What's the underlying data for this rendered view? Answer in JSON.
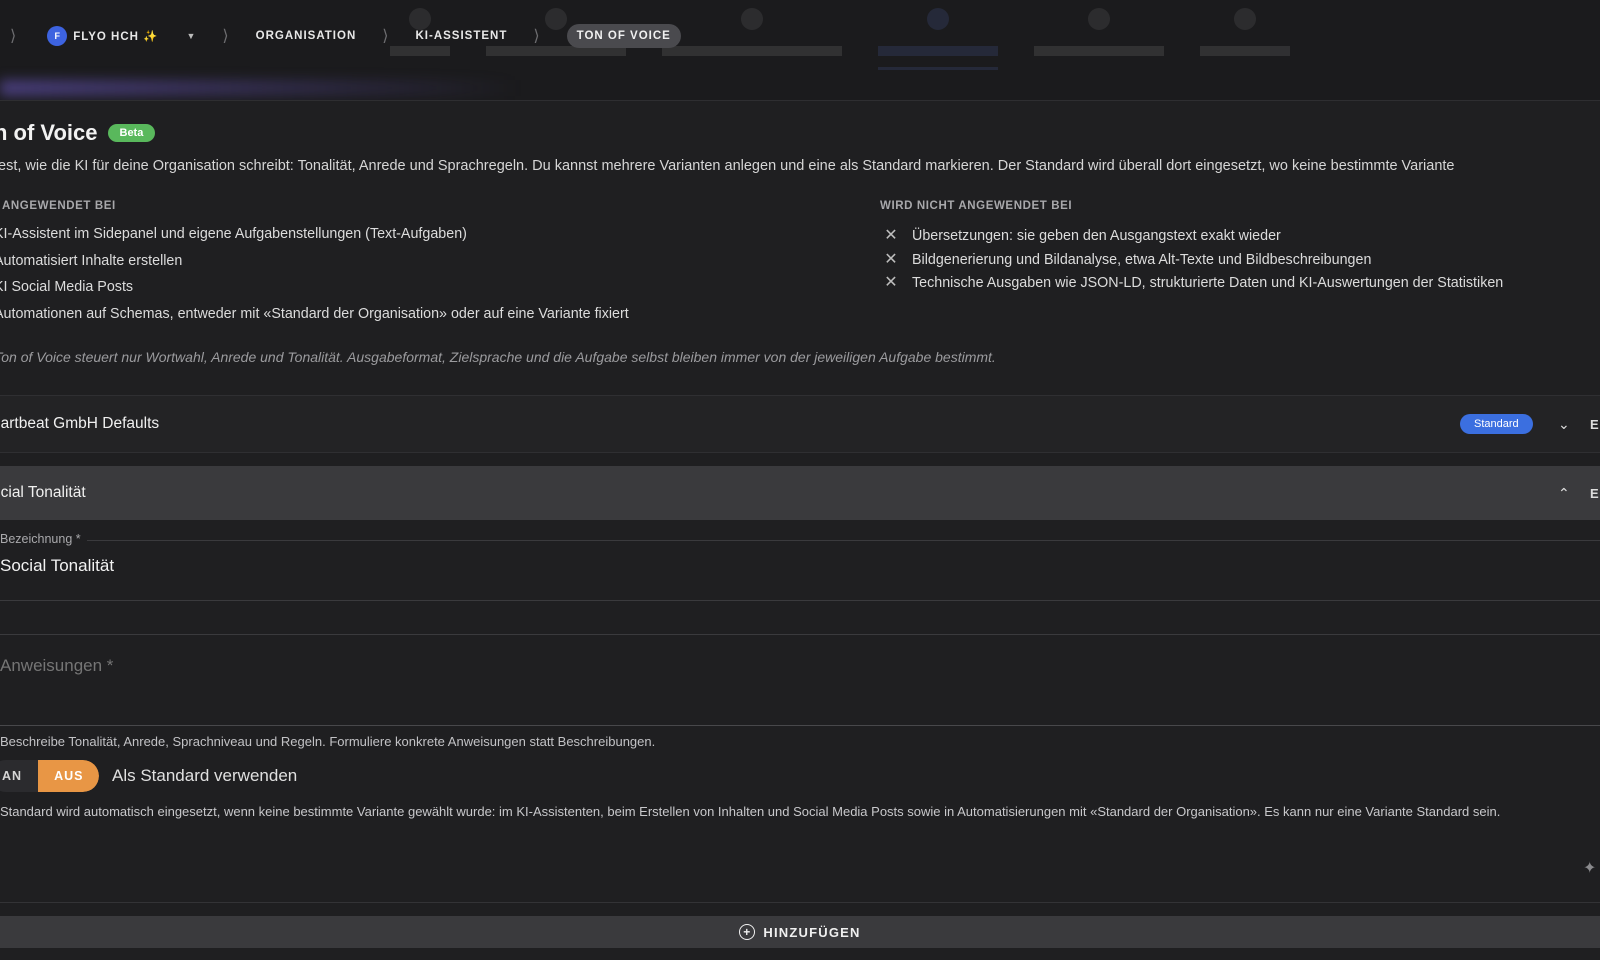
{
  "breadcrumb": {
    "org_avatar": "F",
    "org_name": "FLYO HCH ✨",
    "items": [
      "ORGANISATION",
      "KI-ASSISTENT"
    ],
    "current": "TON OF VOICE"
  },
  "page": {
    "title": "n of Voice",
    "badge": "Beta",
    "intro": "fest, wie die KI für deine Organisation schreibt: Tonalität, Anrede und Sprachregeln. Du kannst mehrere Varianten anlegen und eine als Standard markieren. Der Standard wird überall dort eingesetzt, wo keine bestimmte Variante",
    "applied_heading": "ANGEWENDET BEI",
    "applied": [
      "KI-Assistent im Sidepanel und eigene Aufgabenstellungen (Text-Aufgaben)",
      "Automatisiert Inhalte erstellen",
      "KI Social Media Posts",
      "Automationen auf Schemas, entweder mit «Standard der Organisation» oder auf eine Variante fixiert"
    ],
    "not_applied_heading": "WIRD NICHT ANGEWENDET BEI",
    "not_applied": [
      "Übersetzungen: sie geben den Ausgangstext exakt wieder",
      "Bildgenerierung und Bildanalyse, etwa Alt-Texte und Bildbeschreibungen",
      "Technische Ausgaben wie JSON-LD, strukturierte Daten und KI-Auswertungen der Statistiken"
    ],
    "note": "Ton of Voice steuert nur Wortwahl, Anrede und Tonalität. Ausgabeformat, Zielsprache und die Aufgabe selbst bleiben immer von der jeweiligen Aufgabe bestimmt."
  },
  "variants": [
    {
      "name": "eartbeat GmbH Defaults",
      "badge": "Standard",
      "cut": "E"
    },
    {
      "name": "ocial Tonalität",
      "cut": "E"
    }
  ],
  "form": {
    "name_label": "Bezeichnung *",
    "name_value": "Social Tonalität",
    "instructions_placeholder": "Anweisungen *",
    "helper": "Beschreibe Tonalität, Anrede, Sprachniveau und Regeln. Formuliere konkrete Anweisungen statt Beschreibungen.",
    "toggle_on": "AN",
    "toggle_off": "AUS",
    "toggle_label": "Als Standard verwenden",
    "standard_hint": "r Standard wird automatisch eingesetzt, wenn keine bestimmte Variante gewählt wurde: im KI-Assistenten, beim Erstellen von Inhalten und Social Media Posts sowie in Automatisierungen mit «Standard der Organisation». Es kann nur eine Variante Standard sein."
  },
  "add_button": "HINZUFÜGEN",
  "colors": {
    "background": "#1f1f21",
    "accent_blue": "#3b6fe0",
    "beta_green": "#59b85c",
    "toggle_orange": "#e89645"
  }
}
